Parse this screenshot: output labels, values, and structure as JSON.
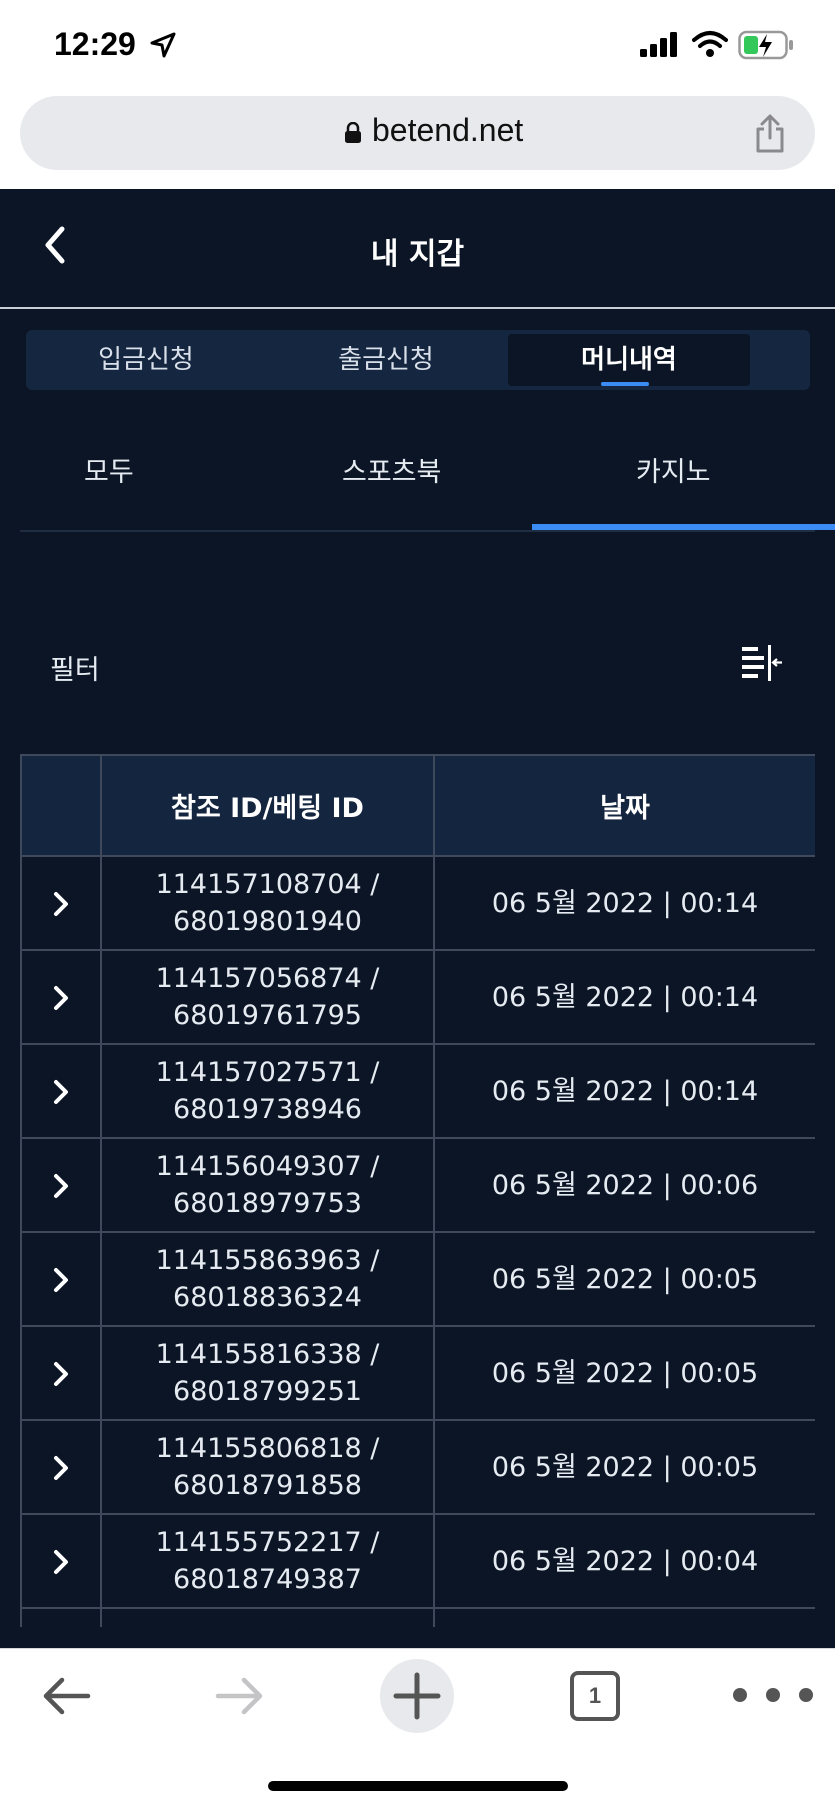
{
  "status_bar": {
    "time": "12:29"
  },
  "browser": {
    "url": "betend.net",
    "tab_count": "1"
  },
  "header": {
    "title": "내 지갑"
  },
  "segments": [
    {
      "label": "입금신청"
    },
    {
      "label": "출금신청"
    },
    {
      "label": "머니내역"
    }
  ],
  "subtabs": [
    {
      "label": "모두"
    },
    {
      "label": "스포츠북"
    },
    {
      "label": "카지노"
    }
  ],
  "filter": {
    "label": "필터"
  },
  "table": {
    "columns": [
      "",
      "참조 ID/베팅 ID",
      "날짜"
    ],
    "rows": [
      {
        "ref": "114157108704 /",
        "bet": "68019801940",
        "date": "06 5월 2022 | 00:14"
      },
      {
        "ref": "114157056874 /",
        "bet": "68019761795",
        "date": "06 5월 2022 | 00:14"
      },
      {
        "ref": "114157027571 /",
        "bet": "68019738946",
        "date": "06 5월 2022 | 00:14"
      },
      {
        "ref": "114156049307 /",
        "bet": "68018979753",
        "date": "06 5월 2022 | 00:06"
      },
      {
        "ref": "114155863963 /",
        "bet": "68018836324",
        "date": "06 5월 2022 | 00:05"
      },
      {
        "ref": "114155816338 /",
        "bet": "68018799251",
        "date": "06 5월 2022 | 00:05"
      },
      {
        "ref": "114155806818 /",
        "bet": "68018791858",
        "date": "06 5월 2022 | 00:05"
      },
      {
        "ref": "114155752217 /",
        "bet": "68018749387",
        "date": "06 5월 2022 | 00:04"
      }
    ]
  },
  "colors": {
    "background": "#0b1525",
    "accent": "#3b8cf5",
    "header_cell": "#14253f"
  }
}
